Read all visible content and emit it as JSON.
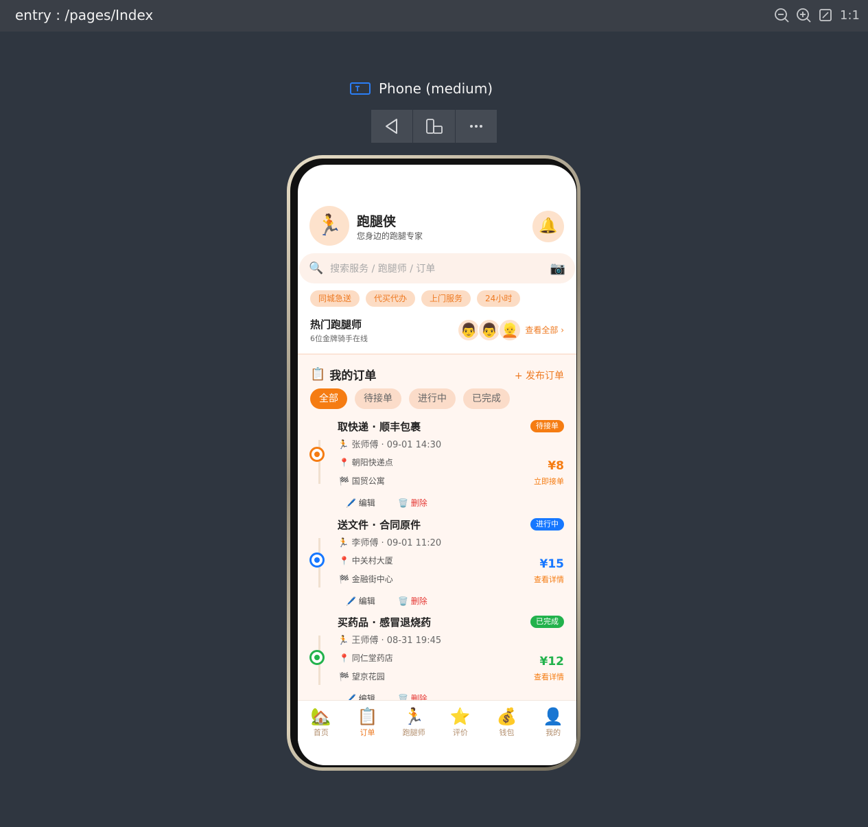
{
  "ide": {
    "path": "entry : /pages/Index",
    "zoom_ratio": "1:1",
    "device_name": "Phone (medium)"
  },
  "app": {
    "title": "跑腿侠",
    "subtitle": "您身边的跑腿专家",
    "search_placeholder": "搜索服务 / 跑腿师 / 订单",
    "chips": [
      "同城急送",
      "代买代办",
      "上门服务",
      "24小时"
    ],
    "hot": {
      "title": "热门跑腿师",
      "subtitle": "6位金牌骑手在线",
      "more": "查看全部 ›"
    },
    "orders": {
      "title": "我的订单",
      "publish": "+ 发布订单",
      "tabs": [
        "全部",
        "待接单",
        "进行中",
        "已完成"
      ],
      "active_tab": "全部",
      "items": [
        {
          "title": "取快递 · 顺丰包裹",
          "status": "待接单",
          "status_color": "#f57c12",
          "runner": "张师傅",
          "time": "09-01 14:30",
          "from": "朝阳快递点",
          "to": "国贸公寓",
          "price": "¥8",
          "action": "立即接单",
          "edit": "编辑",
          "delete": "删除"
        },
        {
          "title": "送文件 · 合同原件",
          "status": "进行中",
          "status_color": "#1677ff",
          "runner": "李师傅",
          "time": "09-01 11:20",
          "from": "中关村大厦",
          "to": "金融街中心",
          "price": "¥15",
          "action": "查看详情",
          "edit": "编辑",
          "delete": "删除"
        },
        {
          "title": "买药品 · 感冒退烧药",
          "status": "已完成",
          "status_color": "#22b24c",
          "runner": "王师傅",
          "time": "08-31 19:45",
          "from": "同仁堂药店",
          "to": "望京花园",
          "price": "¥12",
          "action": "查看详情",
          "edit": "编辑",
          "delete": "删除"
        }
      ]
    },
    "nav": [
      {
        "label": "首页",
        "icon": "house-icon",
        "glyph": "🏡"
      },
      {
        "label": "订单",
        "icon": "clipboard-icon",
        "glyph": "📋"
      },
      {
        "label": "跑腿师",
        "icon": "runner-icon",
        "glyph": "🏃"
      },
      {
        "label": "评价",
        "icon": "star-icon",
        "glyph": "⭐"
      },
      {
        "label": "钱包",
        "icon": "money-bag-icon",
        "glyph": "💰"
      },
      {
        "label": "我的",
        "icon": "user-icon",
        "glyph": "👤"
      }
    ],
    "active_nav": "订单",
    "colors": {
      "accent": "#f57c12",
      "chip_bg": "#fcdcc4",
      "section_bg": "#fff6f1"
    }
  }
}
